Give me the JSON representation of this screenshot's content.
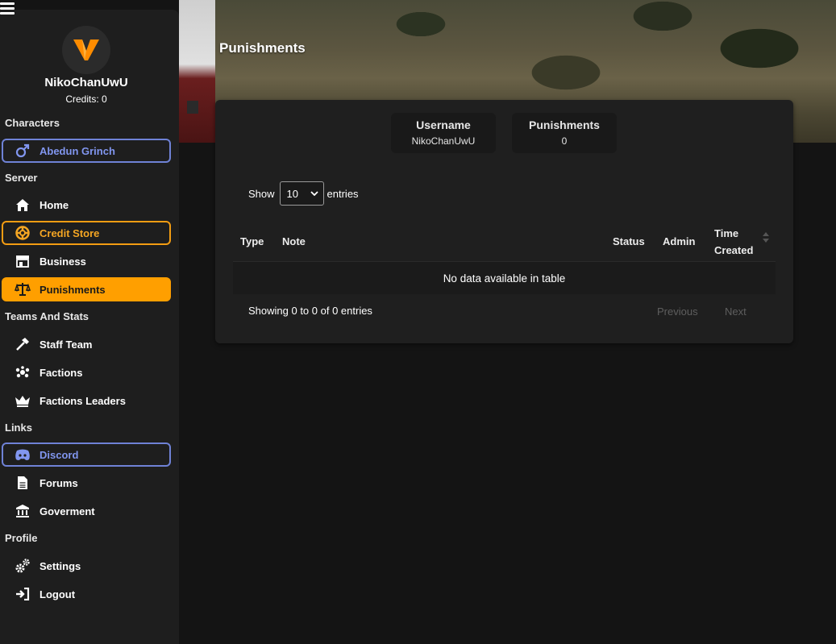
{
  "app": {
    "menu_icon": "hamburger-icon",
    "page_title": "Punishments"
  },
  "profile": {
    "avatar_icon": "v-logo-icon",
    "username": "NikoChanUwU",
    "credits": "Credits: 0"
  },
  "sidebar": {
    "sections": {
      "characters": "Characters",
      "server": "Server",
      "teams": "Teams And Stats",
      "links": "Links",
      "profile": "Profile"
    },
    "items": {
      "character": {
        "label": "Abedun Grinch",
        "icon": "male-icon"
      },
      "home": {
        "label": "Home",
        "icon": "home-icon"
      },
      "credit_store": {
        "label": "Credit Store",
        "icon": "lifebuoy-icon"
      },
      "business": {
        "label": "Business",
        "icon": "store-icon"
      },
      "punishments": {
        "label": "Punishments",
        "icon": "scale-icon"
      },
      "staff_team": {
        "label": "Staff Team",
        "icon": "hammer-icon"
      },
      "factions": {
        "label": "Factions",
        "icon": "group-icon"
      },
      "factions_leaders": {
        "label": "Factions Leaders",
        "icon": "crown-icon"
      },
      "discord": {
        "label": "Discord",
        "icon": "discord-icon"
      },
      "forums": {
        "label": "Forums",
        "icon": "document-icon"
      },
      "goverment": {
        "label": "Goverment",
        "icon": "landmark-icon"
      },
      "settings": {
        "label": "Settings",
        "icon": "gears-icon"
      },
      "logout": {
        "label": "Logout",
        "icon": "logout-icon"
      }
    }
  },
  "summary": {
    "username_label": "Username",
    "username_value": "NikoChanUwU",
    "punishments_label": "Punishments",
    "punishments_value": "0"
  },
  "table": {
    "show_label": "Show",
    "page_size": "10",
    "entries_label": "entries",
    "columns": [
      "Type",
      "Note",
      "Status",
      "Admin",
      "Time Created"
    ],
    "empty_message": "No data available in table",
    "info": "Showing 0 to 0 of 0 entries",
    "previous": "Previous",
    "next": "Next"
  },
  "colors": {
    "accent": "#ff9f00",
    "blue_outline": "#6f82d6",
    "sidebar_bg": "#1e1e1e",
    "card_bg": "#1f1f1f",
    "page_bg": "#141414"
  }
}
